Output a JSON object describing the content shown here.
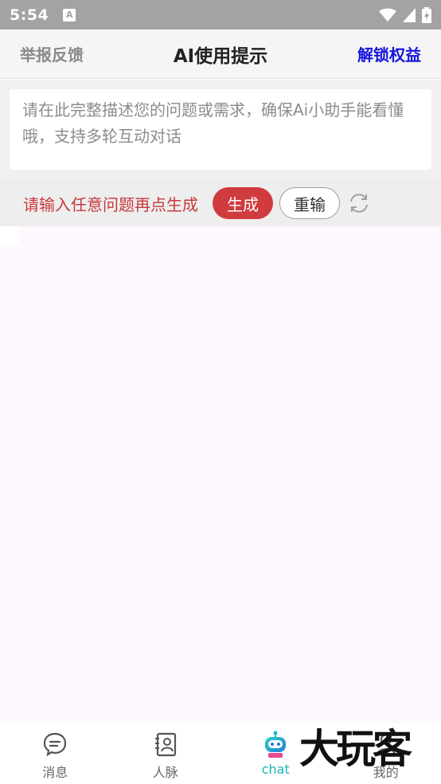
{
  "status_bar": {
    "time": "5:54",
    "app_icon_glyph": "A"
  },
  "header": {
    "left_link": "举报反馈",
    "title": "AI使用提示",
    "right_link": "解锁权益"
  },
  "input": {
    "placeholder": "请在此完整描述您的问题或需求，确保Ai小助手能看懂哦，支持多轮互动对话"
  },
  "actions": {
    "hint": "请输入任意问题再点生成",
    "generate_label": "生成",
    "reset_label": "重输"
  },
  "tabs": [
    {
      "label": "消息",
      "icon": "message-icon"
    },
    {
      "label": "人脉",
      "icon": "contacts-icon"
    },
    {
      "label": "chat",
      "icon": "robot-icon",
      "active": true
    },
    {
      "label": "我的",
      "icon": "user-icon"
    }
  ],
  "watermark": {
    "text": "大玩客"
  },
  "colors": {
    "accent": "#d03b3e",
    "link": "#1515e0",
    "active_tab": "#14b5b0"
  }
}
